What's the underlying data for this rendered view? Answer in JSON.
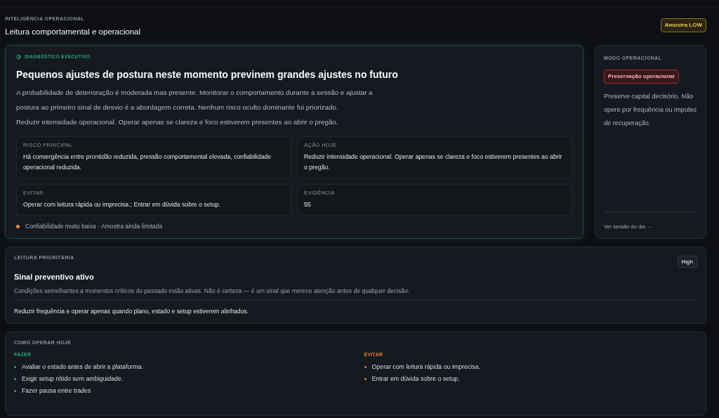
{
  "header": {
    "eyebrow": "INTELIGÊNCIA OPERACIONAL",
    "title": "Leitura comportamental e operacional",
    "sample_badge": "Amostra LOW"
  },
  "diagnosis": {
    "eyebrow": "DIAGNÓSTICO EXECUTIVO",
    "title": "Pequenos ajustes de postura neste momento previnem grandes ajustes no futuro",
    "paragraphs": [
      "A probabilidade de deterioração é moderada mas presente. Monitorar o comportamento durante a sessão e ajustar a postura ao primeiro sinal de desvio é a abordagem correta. Nenhum risco oculto dominante foi priorizado.",
      "Reduzir intensidade operacional. Operar apenas se clareza e foco estiverem presentes ao abrir o pregão."
    ],
    "tiles": [
      {
        "label": "RISCO PRINCIPAL",
        "text": "Há convergência entre prontidão reduzida, pressão comportamental elevada, confiabilidade operacional reduzida."
      },
      {
        "label": "AÇÃO HOJE",
        "text": "Reduzir intensidade operacional. Operar apenas se clareza e foco estiverem presentes ao abrir o pregão."
      },
      {
        "label": "EVITAR",
        "text": "Operar com leitura rápida ou imprecisa.; Entrar em dúvida sobre o setup."
      },
      {
        "label": "EVIDÊNCIA",
        "text": "55"
      }
    ],
    "footnote": {
      "text": "Confiabilidade muito baixa · Amostra ainda limitada",
      "color": "#f0883e"
    }
  },
  "mode": {
    "label": "MODO OPERACIONAL",
    "badge": "Preservação operacional",
    "text": "Preserve capital decisório. Não opere por frequência ou impulso de recuperação.",
    "link": "Ver sessão do dia →"
  },
  "priority": {
    "label": "LEITURA PRIORITÁRIA",
    "badge": "High",
    "title": "Sinal preventivo ativo",
    "text": "Condições semelhantes a momentos críticos do passado estão ativas. Não é certeza — é um sinal que merece atenção antes de qualquer decisão.",
    "action": "Reduzir frequência e operar apenas quando plano, estado e setup estiverem alinhados."
  },
  "how_to": {
    "label": "COMO OPERAR HOJE",
    "columns": [
      {
        "kind": "do",
        "title": "FAZER",
        "items": [
          "Avaliar o estado antes de abrir a plataforma.",
          "Exigir setup nítido sem ambiguidade.",
          "Fazer pausa entre trades"
        ]
      },
      {
        "kind": "avoid",
        "title": "EVITAR",
        "items": [
          "Operar com leitura rápida ou imprecisa.",
          "Entrar em dúvida sobre o setup."
        ]
      }
    ]
  }
}
